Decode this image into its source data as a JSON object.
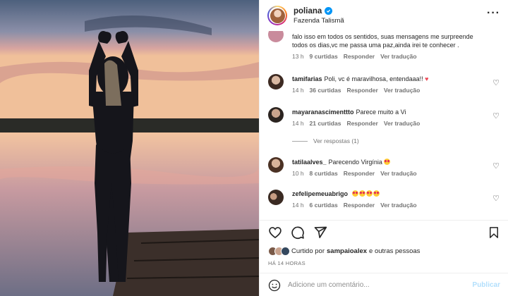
{
  "post": {
    "username": "poliana",
    "location": "Fazenda Talismã",
    "more_icon": "more-horizontal-icon"
  },
  "comments": [
    {
      "username": "",
      "text": "falo isso em todos os sentidos, suas mensagens me surpreende todos os dias,vc me passa uma paz,ainda irei te conhecer .",
      "time": "13 h",
      "likes": "9 curtidas",
      "reply": "Responder",
      "translate": "Ver tradução"
    },
    {
      "username": "tamifarias",
      "text": "Poli, vc é maravilhosa, entendaaa!!",
      "time": "14 h",
      "likes": "36 curtidas",
      "reply": "Responder",
      "translate": "Ver tradução"
    },
    {
      "username": "mayaranascimenttto",
      "text": "Parece muito a Vi",
      "time": "14 h",
      "likes": "21 curtidas",
      "reply": "Responder",
      "translate": "Ver tradução"
    },
    {
      "username": "tatilaalves_",
      "text": "Parecendo Virgínia",
      "time": "10 h",
      "likes": "8 curtidas",
      "reply": "Responder",
      "translate": "Ver tradução"
    },
    {
      "username": "zefelipemeuabrigo",
      "text": "",
      "time": "14 h",
      "likes": "6 curtidas",
      "reply": "Responder",
      "translate": "Ver tradução"
    }
  ],
  "view_replies": "Ver respostas (1)",
  "footer": {
    "liked_prefix": "Curtido por",
    "liked_user": "sampaioalex",
    "liked_suffix": "e outras pessoas",
    "time_ago": "HÁ 14 HORAS",
    "comment_placeholder": "Adicione um comentário...",
    "publish_label": "Publicar"
  },
  "colors": {
    "accent": "#0095f6",
    "publish_disabled": "#b2dffc",
    "heart_red": "#ed4956",
    "meta_gray": "#737373"
  }
}
